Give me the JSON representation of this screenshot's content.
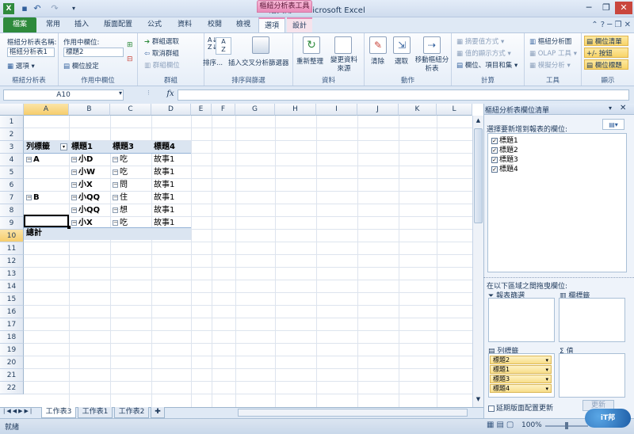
{
  "window": {
    "title": "活頁簿1 - Microsoft Excel",
    "contextual_tab": "樞紐分析表工具"
  },
  "tabs": [
    "檔案",
    "常用",
    "插入",
    "版面配置",
    "公式",
    "資料",
    "校閱",
    "檢視",
    "選項",
    "設計"
  ],
  "ribbon": {
    "pivot_name_label": "樞紐分析表名稱:",
    "pivot_name_value": "樞紐分析表1",
    "pivot_options_btn": "選項",
    "active_field_label": "作用中欄位:",
    "active_field_value": "標題2",
    "field_settings_btn": "欄位設定",
    "group_selection": "群組選取",
    "ungroup": "取消群組",
    "group_field": "群組欄位",
    "sort_btn": "排序...",
    "insert_slicer_btn": "插入交叉分析篩選器",
    "refresh_btn": "重新整理",
    "change_source_btn": "變更資料來源",
    "clear_btn": "清除",
    "select_btn": "選取",
    "move_pivot_btn": "移動樞紐分析表",
    "summarize_by": "摘要值方式",
    "show_values_as": "值的顯示方式",
    "fields_items_sets": "欄位、項目和集",
    "pivot_chart": "樞紐分析圖",
    "olap_tools": "OLAP 工具",
    "what_if": "模擬分析",
    "field_list_btn": "欄位清單",
    "buttons_btn": "+/- 按鈕",
    "field_headers_btn": "欄位標題",
    "groups": [
      "樞紐分析表",
      "作用中欄位",
      "群組",
      "排序與篩選",
      "資料",
      "動作",
      "計算",
      "工具",
      "顯示"
    ]
  },
  "formula_bar": {
    "name_box": "A10",
    "fx": "fx",
    "formula": ""
  },
  "columns": [
    "A",
    "B",
    "C",
    "D",
    "E",
    "F",
    "G",
    "H",
    "I",
    "J",
    "K",
    "L"
  ],
  "rows": [
    "1",
    "2",
    "3",
    "4",
    "5",
    "6",
    "7",
    "8",
    "9",
    "10",
    "11",
    "12",
    "13",
    "14",
    "15",
    "16",
    "17",
    "18",
    "19",
    "20",
    "21",
    "22"
  ],
  "pivot": {
    "headers": [
      "列標籤",
      "標題1",
      "標題3",
      "標題4"
    ],
    "rows": [
      {
        "a": "A",
        "b": "小D",
        "c": "吃",
        "d": "故事1"
      },
      {
        "a": "",
        "b": "小W",
        "c": "吃",
        "d": "故事1"
      },
      {
        "a": "",
        "b": "小X",
        "c": "問",
        "d": "故事1"
      },
      {
        "a": "B",
        "b": "小QQ",
        "c": "住",
        "d": "故事1"
      },
      {
        "a": "",
        "b": "小QQ",
        "c": "想",
        "d": "故事1"
      },
      {
        "a": "",
        "b": "小X",
        "c": "吃",
        "d": "故事1"
      }
    ],
    "grand_total": "總計"
  },
  "sheet_tabs": [
    "工作表3",
    "工作表1",
    "工作表2"
  ],
  "status": {
    "ready": "就緒",
    "zoom": "100%"
  },
  "pane": {
    "title": "樞紐分析表欄位清單",
    "choose_label": "選擇要新增到報表的欄位:",
    "fields": [
      "標題1",
      "標題2",
      "標題3",
      "標題4"
    ],
    "drag_label": "在以下區域之間拖曳欄位:",
    "report_filter": "報表篩選",
    "column_labels": "欄標籤",
    "row_labels": "列標籤",
    "values": "值",
    "row_fields": [
      "標題2",
      "標題1",
      "標題3",
      "標題4"
    ],
    "defer_update": "延期版面配置更新",
    "update_btn": "更新"
  },
  "colors": {
    "accent": "#2e8a3c",
    "pivot_context": "#e98bb9",
    "header_band": "#dbe5f1"
  }
}
